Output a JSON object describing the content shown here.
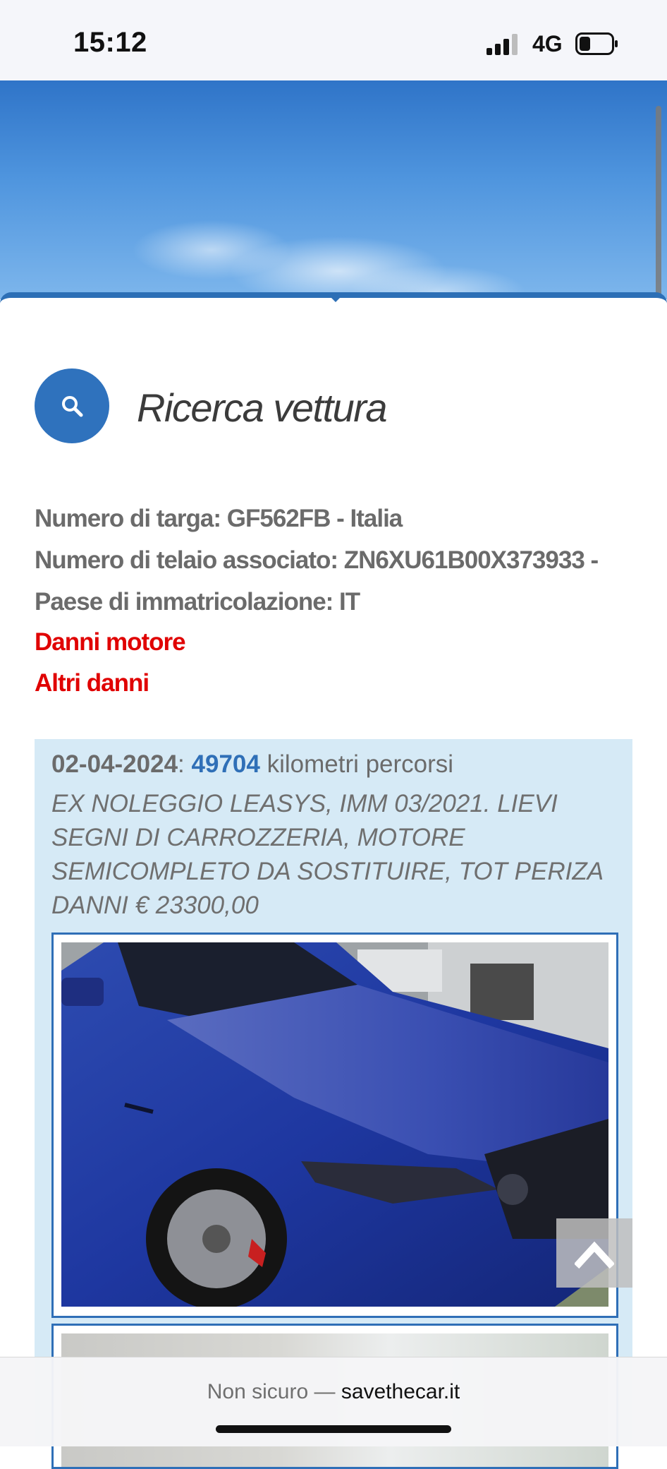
{
  "status_bar": {
    "time": "15:12",
    "network": "4G",
    "battery_level": 0.35
  },
  "search": {
    "title": "Ricerca vettura",
    "icon": "search-icon"
  },
  "vehicle": {
    "plate_line": "Numero di targa: GF562FB - Italia",
    "vin_line": "Numero di telaio associato: ZN6XU61B00X373933 -",
    "country_line": "Paese di immatricolazione: IT",
    "damages": [
      "Danni motore",
      "Altri danni"
    ]
  },
  "record": {
    "date": "02-04-2024",
    "separator": ":",
    "km": "49704",
    "km_label": "kilometri percorsi",
    "description": "EX NOLEGGIO LEASYS, IMM 03/2021. LIEVI SEGNI DI CARROZZERIA, MOTORE SEMICOMPLETO DA SOSTITUIRE, TOT PERIZA DANNI € 23300,00"
  },
  "browser": {
    "security": "Non sicuro —",
    "domain": "savethecar.it"
  },
  "colors": {
    "accent": "#2f72bd",
    "danger": "#e00000",
    "record_bg": "#d6eaf6"
  }
}
